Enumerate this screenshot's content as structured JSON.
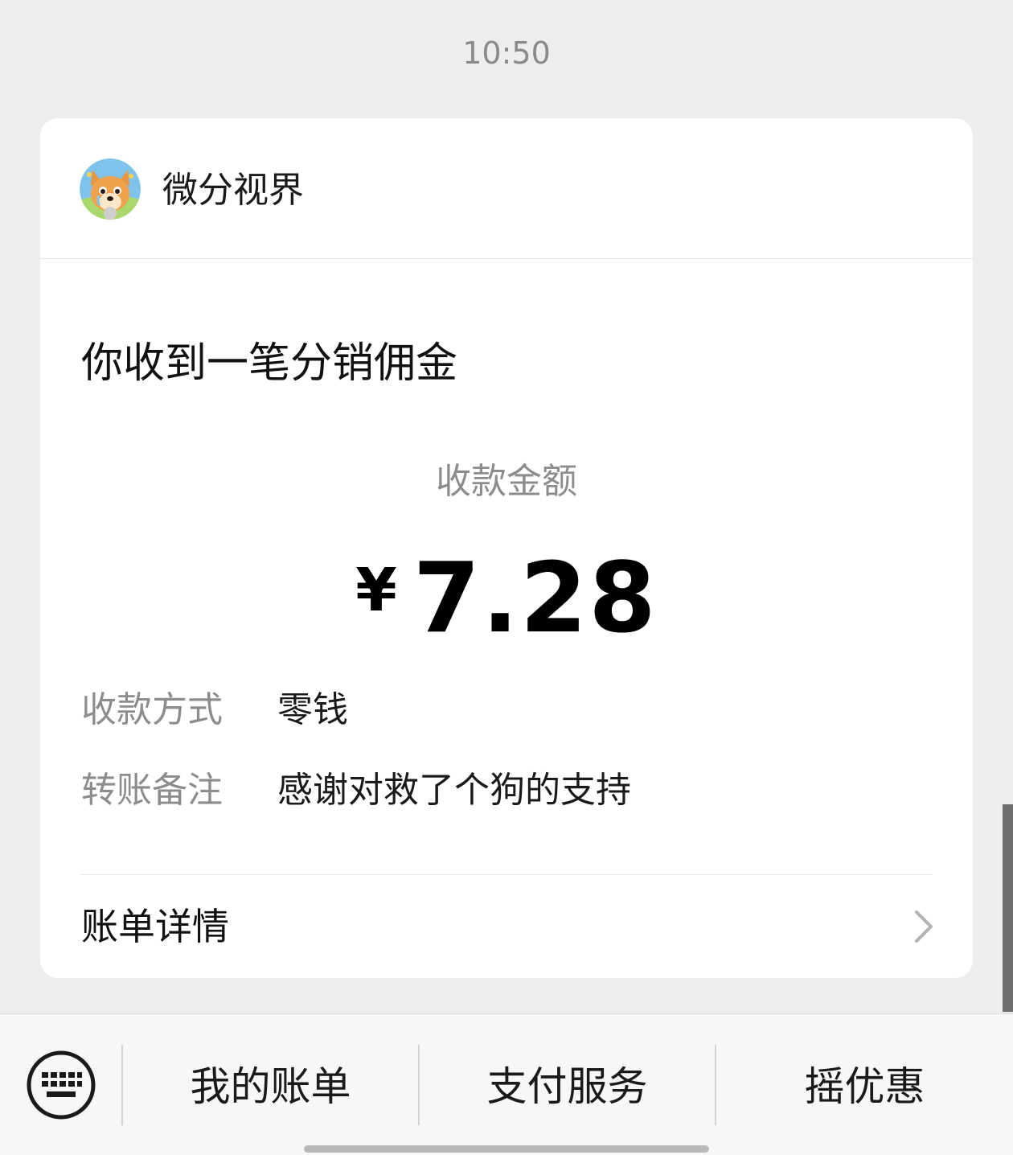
{
  "timestamp": "10:50",
  "card": {
    "merchant_name": "微分视界",
    "notice_title": "你收到一笔分销佣金",
    "amount_label": "收款金额",
    "currency_symbol": "¥",
    "amount": "7.28",
    "info": [
      {
        "label": "收款方式",
        "value": "零钱"
      },
      {
        "label": "转账备注",
        "value": "感谢对救了个狗的支持"
      }
    ],
    "details_label": "账单详情",
    "avatar_icon": "shiba-dog-avatar-icon",
    "chevron_icon": "chevron-right-icon"
  },
  "bottom_bar": {
    "keyboard_icon": "keyboard-icon",
    "items": [
      "我的账单",
      "支付服务",
      "摇优惠"
    ]
  }
}
